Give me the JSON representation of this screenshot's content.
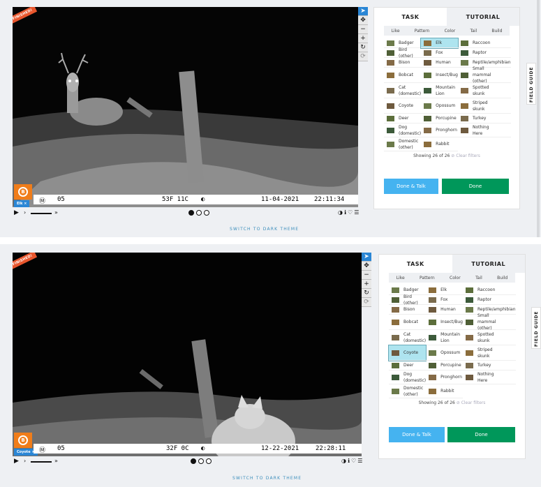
{
  "panels": [
    {
      "finished_badge": "FINISHED!",
      "subject_label": "Elk",
      "info": {
        "frame": "05",
        "temp": "53F 11C",
        "date": "11-04-2021",
        "time": "22:11:34"
      },
      "task": {
        "tabs": [
          "TASK",
          "TUTORIAL"
        ],
        "filters": [
          "Like",
          "Pattern",
          "Color",
          "Tail",
          "Build"
        ],
        "selected": "Elk",
        "showing_text": "Showing 26 of 26",
        "clear_filters": "Clear filters",
        "done_talk": "Done & Talk",
        "done": "Done"
      },
      "field_guide": "FIELD GUIDE",
      "theme_link": "SWITCH TO DARK THEME"
    },
    {
      "finished_badge": "FINISHED!",
      "subject_label": "Coyote",
      "info": {
        "frame": "05",
        "temp": "32F 0C",
        "date": "12-22-2021",
        "time": "22:28:11"
      },
      "task": {
        "tabs": [
          "TASK",
          "TUTORIAL"
        ],
        "filters": [
          "Like",
          "Pattern",
          "Color",
          "Tail",
          "Build"
        ],
        "selected": "Coyote",
        "showing_text": "Showing 26 of 26",
        "clear_filters": "Clear filters",
        "done_talk": "Done & Talk",
        "done": "Done"
      },
      "field_guide": "FIELD GUIDE",
      "theme_link": "SWITCH TO DARK THEME"
    }
  ],
  "choices": [
    [
      "Badger"
    ],
    [
      "Elk"
    ],
    [
      "Raccoon"
    ],
    [
      "Bird (other)"
    ],
    [
      "Fox"
    ],
    [
      "Raptor"
    ],
    [
      "Bison"
    ],
    [
      "Human"
    ],
    [
      "Reptile/amphibian"
    ],
    [
      "Bobcat"
    ],
    [
      "Insect/Bug"
    ],
    [
      "Small",
      "mammal",
      "(other)"
    ],
    [
      "Cat",
      "(domestic)"
    ],
    [
      "Mountain",
      "Lion"
    ],
    [
      "Spotted",
      "skunk"
    ],
    [
      "Coyote"
    ],
    [
      "Opossum"
    ],
    [
      "Striped",
      "skunk"
    ],
    [
      "Deer"
    ],
    [
      "Porcupine"
    ],
    [
      "Turkey"
    ],
    [
      "Dog",
      "(domestic)"
    ],
    [
      "Pronghorn"
    ],
    [
      "Nothing",
      "Here"
    ],
    [
      "Domestic",
      "(other)"
    ],
    [
      "Rabbit"
    ]
  ],
  "icons": {
    "tools": [
      "pointer-icon",
      "move-icon",
      "zoom-out-icon",
      "zoom-in-icon",
      "rotate-icon",
      "reset-icon"
    ],
    "playback": [
      "play-icon",
      "step-forward-icon",
      "fast-forward-icon"
    ],
    "image_actions": [
      "invert-icon",
      "info-icon",
      "favorite-icon",
      "collections-icon"
    ]
  },
  "colors": {
    "accent": "#2a86d5",
    "done": "#00975a",
    "done_talk": "#45b3f0",
    "finished": "#e8562d",
    "selected": "#aee4ef"
  }
}
